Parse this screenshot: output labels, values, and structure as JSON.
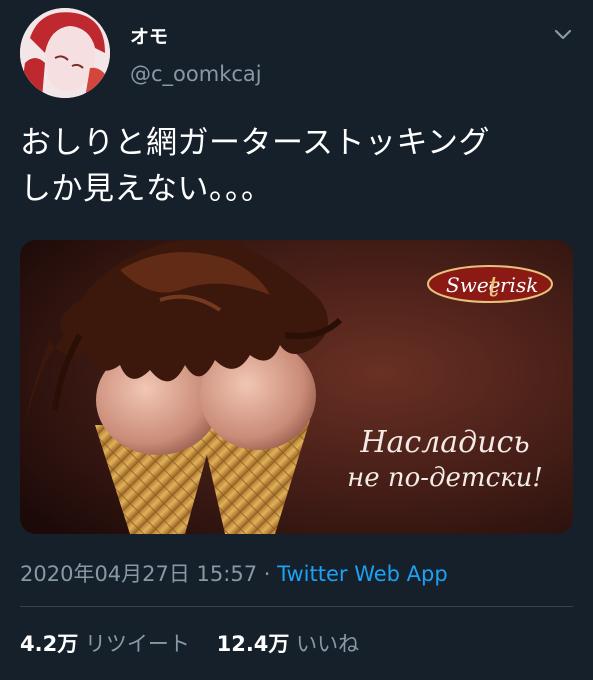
{
  "tweet": {
    "display_name": "オモ",
    "handle": "@c_oomkcaj",
    "text": "おしりと網ガーターストッキング\nしか見えない。。。",
    "timestamp": "2020年04月27日 15:57",
    "separator": "·",
    "source_app": "Twitter Web App"
  },
  "media": {
    "brand_left": "Swee",
    "brand_mid": "t",
    "brand_right": "risk",
    "slogan_line1": "Насладись",
    "slogan_line2": "не по-детски!"
  },
  "stats": {
    "retweets_count": "4.2万",
    "retweets_label": "リツイート",
    "likes_count": "12.4万",
    "likes_label": "いいね"
  },
  "colors": {
    "background": "#15202b",
    "secondary_text": "#8899a6",
    "link": "#1da1f2",
    "divider": "#38444d"
  },
  "icons": {
    "caret": "chevron-down-icon",
    "avatar": "avatar"
  }
}
